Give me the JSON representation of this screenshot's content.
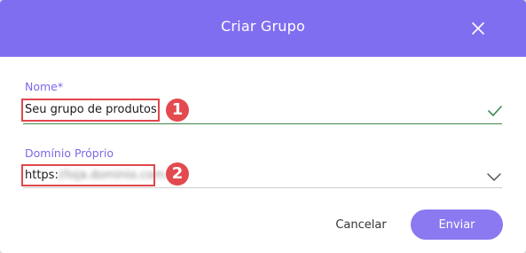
{
  "dialog": {
    "title": "Criar Grupo",
    "close_icon": "close-icon"
  },
  "fields": {
    "name": {
      "label": "Nome",
      "required_mark": "*",
      "value": "Seu grupo de produtos",
      "status_icon": "check-icon"
    },
    "domain": {
      "label": "Domínio Próprio",
      "value_prefix": "https:",
      "value_redacted": "//loja.dominio.com.br",
      "dropdown_icon": "chevron-down-icon"
    }
  },
  "annotations": {
    "step_1": "1",
    "step_2": "2"
  },
  "actions": {
    "cancel_label": "Cancelar",
    "submit_label": "Enviar"
  },
  "colors": {
    "header": "#806ef0",
    "accent": "#7b69e8",
    "valid": "#3e8a4f",
    "highlight": "#e0474c"
  }
}
